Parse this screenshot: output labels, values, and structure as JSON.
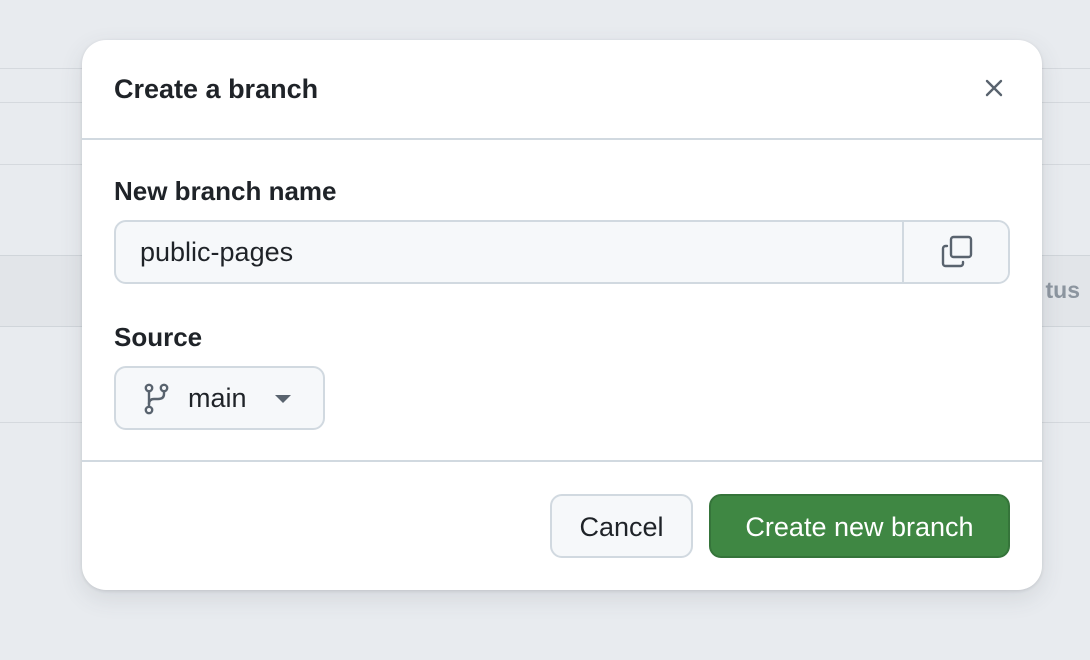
{
  "background": {
    "column_header_fragment": "tus"
  },
  "dialog": {
    "title": "Create a branch",
    "close_icon": "x-icon",
    "branch_name": {
      "label": "New branch name",
      "value": "public-pages",
      "copy_icon": "copy-icon"
    },
    "source": {
      "label": "Source",
      "branch_icon": "git-branch-icon",
      "selected": "main",
      "caret_icon": "triangle-down-icon"
    },
    "footer": {
      "cancel_label": "Cancel",
      "create_label": "Create new branch"
    }
  },
  "colors": {
    "primary_button": "#3f8743",
    "border": "#d1d9e0",
    "backdrop": "#e8ebef"
  }
}
